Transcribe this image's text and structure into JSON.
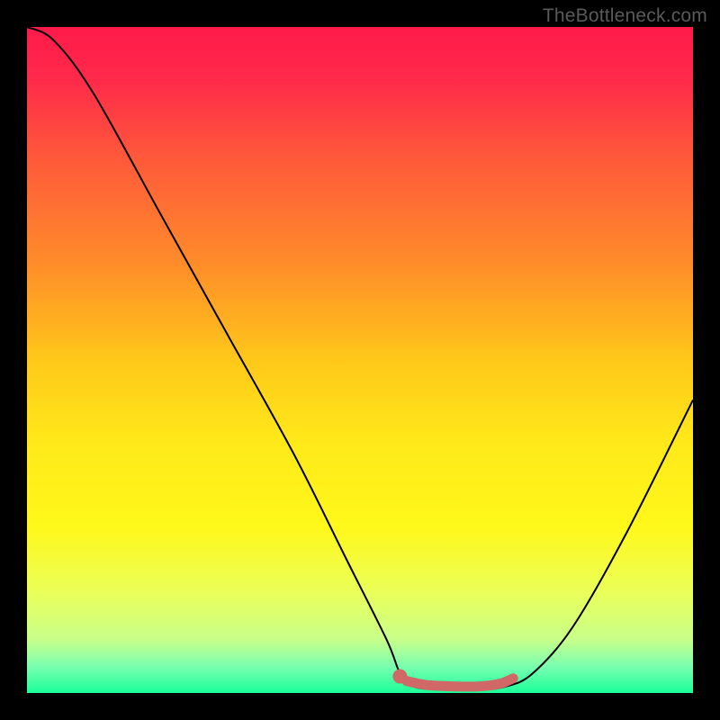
{
  "watermark": "TheBottleneck.com",
  "chart_data": {
    "type": "line",
    "title": "",
    "xlabel": "",
    "ylabel": "",
    "xlim": [
      0,
      100
    ],
    "ylim": [
      0,
      100
    ],
    "gradient_stops": [
      {
        "offset": 0.0,
        "color": "#ff1a4a"
      },
      {
        "offset": 0.08,
        "color": "#ff2a4a"
      },
      {
        "offset": 0.2,
        "color": "#ff5a3a"
      },
      {
        "offset": 0.35,
        "color": "#ff8a2a"
      },
      {
        "offset": 0.5,
        "color": "#ffc81a"
      },
      {
        "offset": 0.62,
        "color": "#ffe81a"
      },
      {
        "offset": 0.75,
        "color": "#fff81a"
      },
      {
        "offset": 0.85,
        "color": "#eaff5a"
      },
      {
        "offset": 0.92,
        "color": "#c8ff8a"
      },
      {
        "offset": 0.96,
        "color": "#7affb0"
      },
      {
        "offset": 1.0,
        "color": "#1aff9a"
      }
    ],
    "series": [
      {
        "name": "bottleneck-curve",
        "color": "#000000",
        "points": [
          {
            "x": 0.0,
            "y": 100.0
          },
          {
            "x": 4.0,
            "y": 98.0
          },
          {
            "x": 10.0,
            "y": 90.0
          },
          {
            "x": 20.0,
            "y": 72.0
          },
          {
            "x": 30.0,
            "y": 54.0
          },
          {
            "x": 40.0,
            "y": 36.0
          },
          {
            "x": 48.0,
            "y": 20.0
          },
          {
            "x": 54.0,
            "y": 8.0
          },
          {
            "x": 56.0,
            "y": 3.0
          },
          {
            "x": 58.0,
            "y": 1.0
          },
          {
            "x": 62.0,
            "y": 0.5
          },
          {
            "x": 68.0,
            "y": 0.5
          },
          {
            "x": 72.0,
            "y": 1.0
          },
          {
            "x": 76.0,
            "y": 3.0
          },
          {
            "x": 82.0,
            "y": 10.0
          },
          {
            "x": 90.0,
            "y": 24.0
          },
          {
            "x": 100.0,
            "y": 44.0
          }
        ]
      },
      {
        "name": "optimal-range",
        "type": "marker-band",
        "color": "#d06868",
        "start_marker": {
          "x": 56.0,
          "y": 2.5,
          "r": 1.2
        },
        "band": [
          {
            "x": 57.0,
            "y": 1.8
          },
          {
            "x": 60.0,
            "y": 1.2
          },
          {
            "x": 64.0,
            "y": 1.0
          },
          {
            "x": 68.0,
            "y": 1.0
          },
          {
            "x": 71.0,
            "y": 1.4
          },
          {
            "x": 73.0,
            "y": 2.2
          }
        ]
      }
    ]
  }
}
